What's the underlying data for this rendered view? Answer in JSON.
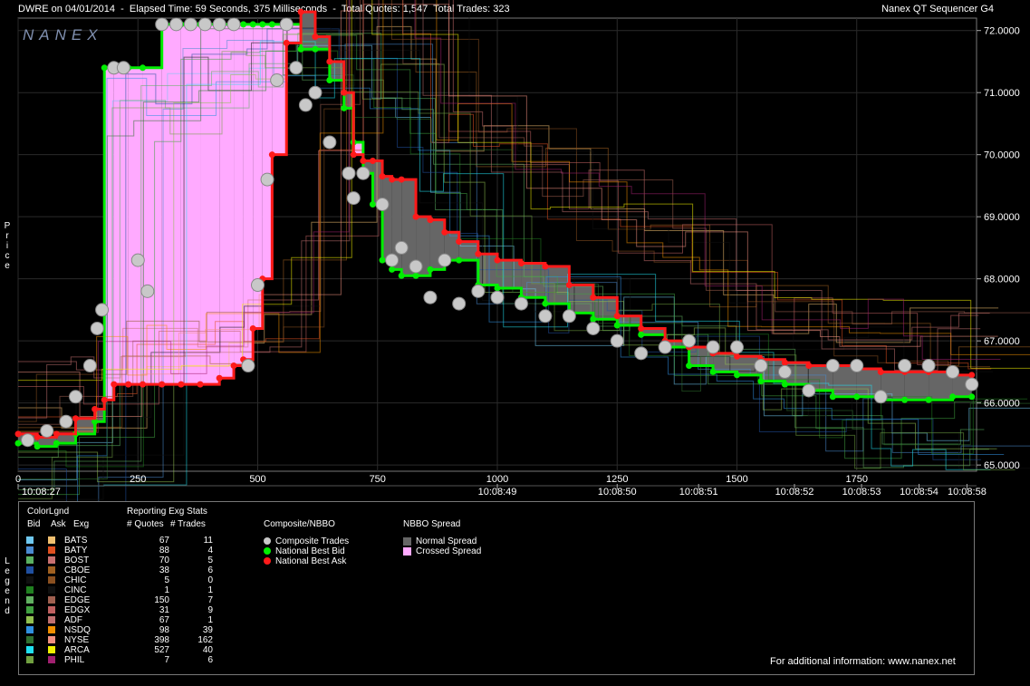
{
  "header": {
    "title_left": "DWRE on 04/01/2014  -  Elapsed Time: 59 Seconds, 375 Milliseconds  -  Total Quotes: 1,547  Total Trades: 323",
    "title_right": "Nanex QT Sequencer G4",
    "logo": "NANEX",
    "ylabel": "Price",
    "legend_side_label": "Legend"
  },
  "colors": {
    "bid": "#00ee00",
    "ask": "#ff1a1a",
    "trade": "#c8c8c8",
    "normal_spread": "#666666",
    "crossed_spread": "#ffaaff"
  },
  "chart_data": {
    "type": "line",
    "title": "DWRE on 04/01/2014",
    "xlabel": "",
    "ylabel": "Price",
    "x_ticks": [
      0,
      250,
      500,
      750,
      1000,
      1250,
      1500,
      1750
    ],
    "x_time_labels": [
      {
        "x": 0,
        "label": "10:08:27"
      },
      {
        "x": 1000,
        "label": "10:08:49"
      },
      {
        "x": 1250,
        "label": "10:08:50"
      },
      {
        "x": 1420,
        "label": "10:08:51"
      },
      {
        "x": 1620,
        "label": "10:08:52"
      },
      {
        "x": 1760,
        "label": "10:08:53"
      },
      {
        "x": 1880,
        "label": "10:08:54"
      },
      {
        "x": 1980,
        "label": "10:08:58"
      }
    ],
    "xlim": [
      0,
      2000
    ],
    "ylim": [
      64.9,
      72.2
    ],
    "y_ticks": [
      65.0,
      66.0,
      67.0,
      68.0,
      69.0,
      70.0,
      71.0,
      72.0
    ],
    "y_tick_labels": [
      "65.0000",
      "66.0000",
      "67.0000",
      "68.0000",
      "69.0000",
      "70.0000",
      "71.0000",
      "72.0000"
    ],
    "series": [
      {
        "name": "National Best Bid",
        "x": [
          0,
          40,
          80,
          120,
          160,
          180,
          200,
          230,
          260,
          300,
          340,
          380,
          420,
          450,
          470,
          490,
          510,
          530,
          560,
          590,
          620,
          650,
          680,
          700,
          720,
          740,
          760,
          780,
          800,
          830,
          860,
          890,
          920,
          960,
          1000,
          1050,
          1100,
          1150,
          1200,
          1250,
          1300,
          1350,
          1400,
          1450,
          1500,
          1550,
          1600,
          1650,
          1700,
          1750,
          1800,
          1850,
          1900,
          1950,
          1990
        ],
        "values": [
          65.35,
          65.3,
          65.35,
          65.5,
          65.7,
          71.4,
          71.4,
          71.4,
          71.4,
          72.1,
          72.1,
          72.1,
          72.1,
          72.1,
          72.1,
          72.1,
          72.1,
          72.1,
          72.1,
          71.7,
          71.7,
          71.2,
          70.75,
          70.2,
          69.7,
          69.2,
          68.3,
          68.15,
          68.05,
          68.05,
          68.15,
          68.3,
          68.3,
          67.9,
          67.85,
          67.7,
          67.6,
          67.45,
          67.35,
          67.25,
          67.1,
          66.9,
          66.6,
          66.5,
          66.45,
          66.35,
          66.3,
          66.2,
          66.1,
          66.1,
          66.05,
          66.05,
          66.05,
          66.1,
          66.1
        ]
      },
      {
        "name": "National Best Ask",
        "x": [
          0,
          40,
          80,
          120,
          160,
          180,
          200,
          230,
          260,
          300,
          340,
          380,
          420,
          450,
          470,
          490,
          510,
          530,
          560,
          590,
          620,
          650,
          680,
          700,
          720,
          740,
          760,
          780,
          800,
          830,
          860,
          890,
          920,
          960,
          1000,
          1050,
          1100,
          1150,
          1200,
          1250,
          1300,
          1350,
          1400,
          1450,
          1500,
          1550,
          1600,
          1650,
          1700,
          1750,
          1800,
          1850,
          1900,
          1950,
          1990
        ],
        "values": [
          65.5,
          65.45,
          65.5,
          65.75,
          65.9,
          66.05,
          66.3,
          66.3,
          66.3,
          66.3,
          66.3,
          66.3,
          66.4,
          66.6,
          66.7,
          67.2,
          68.0,
          70.0,
          71.8,
          72.3,
          71.9,
          71.5,
          71.0,
          70.0,
          69.9,
          69.9,
          69.65,
          69.6,
          69.6,
          69.0,
          68.95,
          68.75,
          68.6,
          68.4,
          68.3,
          68.25,
          68.2,
          67.9,
          67.7,
          67.4,
          67.2,
          67.0,
          66.9,
          66.8,
          66.75,
          66.7,
          66.65,
          66.6,
          66.6,
          66.55,
          66.5,
          66.5,
          66.5,
          66.45,
          66.45
        ]
      },
      {
        "name": "Composite Trades",
        "x": [
          20,
          60,
          100,
          120,
          150,
          165,
          175,
          200,
          220,
          250,
          270,
          300,
          330,
          360,
          390,
          420,
          450,
          480,
          500,
          520,
          540,
          560,
          580,
          600,
          620,
          650,
          690,
          700,
          720,
          760,
          780,
          800,
          830,
          860,
          890,
          920,
          960,
          1000,
          1050,
          1100,
          1150,
          1200,
          1250,
          1300,
          1350,
          1400,
          1450,
          1500,
          1550,
          1600,
          1650,
          1700,
          1750,
          1800,
          1850,
          1900,
          1950,
          1990
        ],
        "values": [
          65.4,
          65.55,
          65.7,
          66.1,
          66.6,
          67.2,
          67.5,
          71.4,
          71.4,
          68.3,
          67.8,
          72.1,
          72.1,
          72.1,
          72.1,
          72.1,
          72.1,
          66.6,
          67.9,
          69.6,
          71.2,
          72.1,
          71.4,
          70.8,
          71.0,
          70.2,
          69.7,
          69.3,
          69.7,
          69.2,
          68.3,
          68.5,
          68.2,
          67.7,
          68.3,
          67.6,
          67.8,
          67.7,
          67.6,
          67.4,
          67.4,
          67.2,
          67.0,
          66.8,
          66.9,
          67.0,
          66.9,
          66.9,
          66.6,
          66.5,
          66.2,
          66.6,
          66.6,
          66.1,
          66.6,
          66.6,
          66.5,
          66.3
        ]
      }
    ],
    "legend_composite": [
      "Composite Trades",
      "National Best Bid",
      "National Best Ask"
    ],
    "legend_spread": [
      "Normal Spread",
      "Crossed Spread"
    ]
  },
  "legend": {
    "colorlgnd_label": "ColorLgnd",
    "col_bid": "Bid",
    "col_ask": "Ask",
    "col_exg": "Exg",
    "stats_title": "Reporting Exg Stats",
    "col_quotes": "# Quotes",
    "col_trades": "# Trades",
    "composite_title": "Composite/NBBO",
    "composite_items": [
      {
        "label": "Composite Trades",
        "color": "#c8c8c8"
      },
      {
        "label": "National Best Bid",
        "color": "#00ee00"
      },
      {
        "label": "National Best Ask",
        "color": "#ff1a1a"
      }
    ],
    "spread_title": "NBBO Spread",
    "spread_items": [
      {
        "label": "Normal Spread",
        "color": "#666666"
      },
      {
        "label": "Crossed Spread",
        "color": "#ffaaff"
      }
    ],
    "footer": "For additional information: www.nanex.net",
    "exchanges": [
      {
        "exg": "BATS",
        "quotes": "67",
        "trades": "11",
        "bid_color": "#6fc8f0",
        "ask_color": "#f0c070"
      },
      {
        "exg": "BATY",
        "quotes": "88",
        "trades": "4",
        "bid_color": "#4a8ad0",
        "ask_color": "#e05020"
      },
      {
        "exg": "BOST",
        "quotes": "70",
        "trades": "5",
        "bid_color": "#5ab060",
        "ask_color": "#c87070"
      },
      {
        "exg": "CBOE",
        "quotes": "38",
        "trades": "6",
        "bid_color": "#2050a0",
        "ask_color": "#a06020"
      },
      {
        "exg": "CHIC",
        "quotes": "5",
        "trades": "0",
        "bid_color": "#101010",
        "ask_color": "#8a5020"
      },
      {
        "exg": "CINC",
        "quotes": "1",
        "trades": "1",
        "bid_color": "#208020",
        "ask_color": "#101010"
      },
      {
        "exg": "EDGE",
        "quotes": "150",
        "trades": "7",
        "bid_color": "#60b060",
        "ask_color": "#a06050"
      },
      {
        "exg": "EDGX",
        "quotes": "31",
        "trades": "9",
        "bid_color": "#40a040",
        "ask_color": "#c06060"
      },
      {
        "exg": "ADF",
        "quotes": "67",
        "trades": "1",
        "bid_color": "#90c050",
        "ask_color": "#c07070"
      },
      {
        "exg": "NSDQ",
        "quotes": "98",
        "trades": "39",
        "bid_color": "#3090e0",
        "ask_color": "#f09000"
      },
      {
        "exg": "NYSE",
        "quotes": "398",
        "trades": "162",
        "bid_color": "#307030",
        "ask_color": "#f09080"
      },
      {
        "exg": "ARCA",
        "quotes": "527",
        "trades": "40",
        "bid_color": "#20e0f0",
        "ask_color": "#f0f000"
      },
      {
        "exg": "PHIL",
        "quotes": "7",
        "trades": "6",
        "bid_color": "#70a040",
        "ask_color": "#a02070"
      }
    ]
  }
}
